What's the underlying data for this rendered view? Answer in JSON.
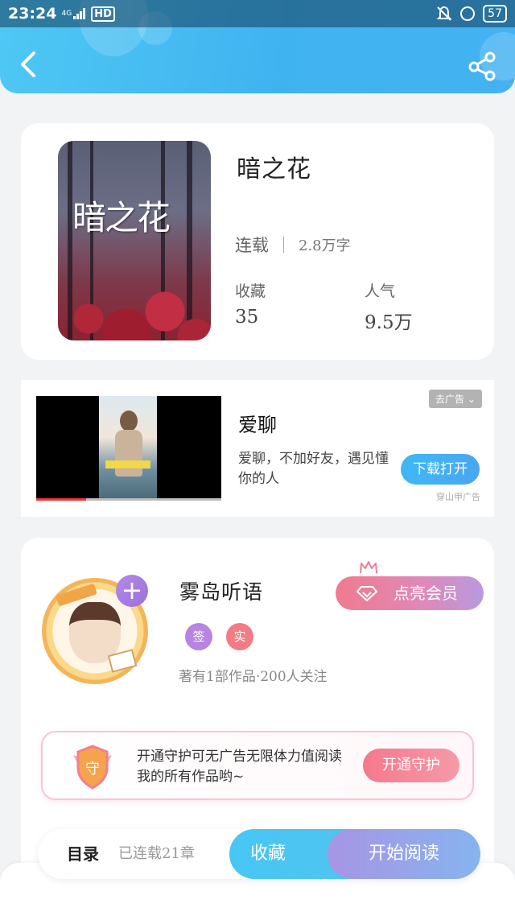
{
  "status_bar": {
    "time": "23:24",
    "network": "4G",
    "hd": "HD",
    "battery": "57"
  },
  "header": {
    "back_icon": "chevron-left-icon",
    "share_icon": "share-icon"
  },
  "book": {
    "cover_title": "暗之花",
    "title": "暗之花",
    "status": "连载",
    "word_count": "2.8万字",
    "stats": [
      {
        "label": "收藏",
        "value": "35"
      },
      {
        "label": "人气",
        "value": "9.5万"
      }
    ]
  },
  "ad": {
    "remove_label": "去广告 ⌄",
    "name": "爱聊",
    "description": "爱聊，不加好友，遇见懂你的人",
    "button_label": "下载打开",
    "source": "穿山甲广告",
    "video_progress": 0.27
  },
  "author": {
    "name": "雾岛听语",
    "badges": [
      {
        "text": "签",
        "color": "#b784e2"
      },
      {
        "text": "实",
        "color": "#f37c84"
      }
    ],
    "meta": "著有1部作品·200人关注",
    "follow_label": "+",
    "vip_label": "点亮会员"
  },
  "guard": {
    "shield_text": "守",
    "text": "开通守护可无广告无限体力值阅读我的所有作品哟~",
    "button_label": "开通守护"
  },
  "bottom_bar": {
    "toc_label": "目录",
    "chapters": "已连载21章",
    "collect_label": "收藏",
    "read_label": "开始阅读"
  },
  "colors": {
    "header_blue": "#45b9f2",
    "vip_pink": "#f07a8f",
    "purple": "#a795e4"
  }
}
